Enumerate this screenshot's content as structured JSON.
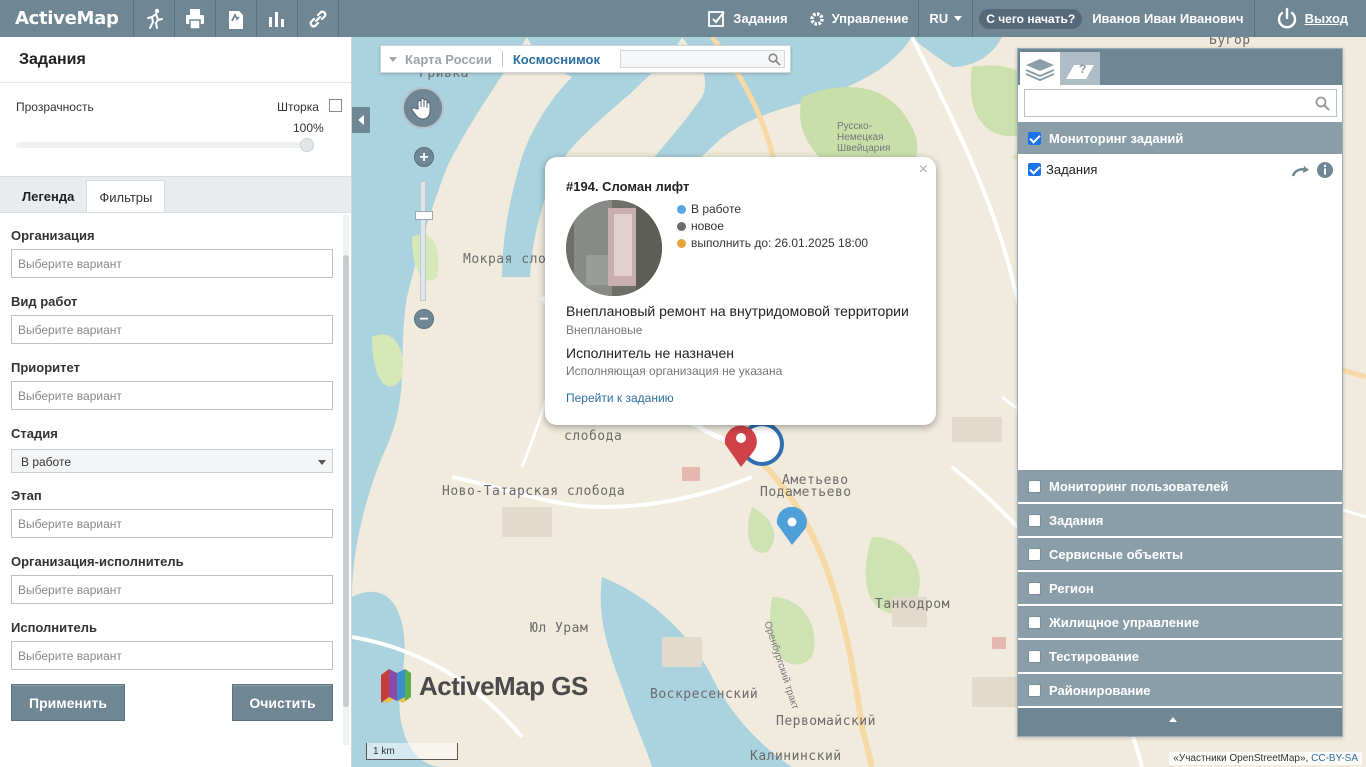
{
  "header": {
    "brand": "ActiveMap",
    "tasks_label": "Задания",
    "manage_label": "Управление",
    "lang": "RU",
    "help_label": "С чего начать?",
    "user_name": "Иванов Иван Иванович",
    "logout_label": "Выход",
    "icons": [
      "running-icon",
      "print-icon",
      "document-icon",
      "bar-chart-icon",
      "link-icon"
    ]
  },
  "left_panel": {
    "title": "Задания",
    "transparency_label": "Прозрачность",
    "shtorka_label": "Шторка",
    "transparency_value": "100%",
    "tabs": [
      "Легенда",
      "Фильтры"
    ],
    "filters": [
      {
        "label": "Организация",
        "placeholder": "Выберите вариант"
      },
      {
        "label": "Вид работ",
        "placeholder": "Выберите вариант"
      },
      {
        "label": "Приоритет",
        "placeholder": "Выберите вариант"
      },
      {
        "label": "Стадия",
        "value": "В работе"
      },
      {
        "label": "Этап",
        "placeholder": "Выберите вариант"
      },
      {
        "label": "Организация-исполнитель",
        "placeholder": "Выберите вариант"
      },
      {
        "label": "Исполнитель",
        "placeholder": "Выберите вариант"
      }
    ],
    "apply_label": "Применить",
    "clear_label": "Очистить"
  },
  "map": {
    "switch_inactive": "Карта России",
    "switch_active": "Космоснимок",
    "labels": [
      "Гривка",
      "Мокрая слобода",
      "слобода",
      "Ново-Татарская слобода",
      "Аметьево",
      "Подаметьево",
      "Танкодром",
      "Юл Урам",
      "Воскресенский",
      "Первомайский",
      "Оренбургский тракт",
      "Русско-Немецкая Швейцария",
      "Бугор",
      "Калининский"
    ],
    "watermark": "ActiveMap GS",
    "scale": "1 km",
    "attribution_prefix": "«Участники OpenStreetMap»,",
    "attribution_link": "CC-BY-SA"
  },
  "popup": {
    "title": "#194. Сломан лифт",
    "statuses": [
      {
        "text": "В работе",
        "color": "#5aa5e0"
      },
      {
        "text": "новое",
        "color": "#6d6d6d"
      },
      {
        "text": "выполнить до: 26.01.2025 18:00",
        "color": "#e9a33a"
      }
    ],
    "description": "Внеплановый ремонт на внутридомовой территории",
    "type": "Внеплановые",
    "executor": "Исполнитель не назначен",
    "executor_org": "Исполняющая организация не указана",
    "link": "Перейти к заданию"
  },
  "right_panel": {
    "active_group": "Мониторинг заданий",
    "active_layer": "Задания",
    "groups": [
      "Мониторинг пользователей",
      "Задания",
      "Сервисные объекты",
      "Регион",
      "Жилищное управление",
      "Тестирование",
      "Районирование"
    ]
  },
  "colors": {
    "header": "#6f8694",
    "accent": "#2b6fa0",
    "marker_red": "#d0414a",
    "marker_blue": "#4f9fd8"
  }
}
